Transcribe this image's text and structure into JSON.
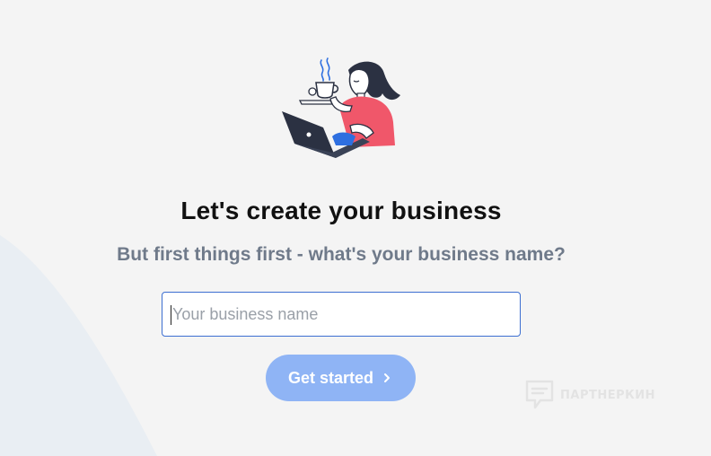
{
  "heading": {
    "title": "Let's create your business",
    "subtitle": "But first things first - what's your business name?"
  },
  "form": {
    "business_name_placeholder": "Your business name",
    "business_name_value": "",
    "submit_label": "Get started"
  },
  "watermark": {
    "text": "ПАРТНЕРКИН"
  },
  "icons": {
    "illustration": "woman-with-coffee-and-laptop-illustration",
    "submit_icon": "chevron-right-icon",
    "watermark_icon": "chat-bubble-logo-icon"
  },
  "colors": {
    "background": "#f4f4f4",
    "title": "#111111",
    "subtitle": "#6f7a8a",
    "input_border": "#3d6fd1",
    "button": "#8fb4f5",
    "illustration_sweater": "#f0576a",
    "illustration_dark": "#2b3142",
    "illustration_blue": "#2e6fe0"
  }
}
